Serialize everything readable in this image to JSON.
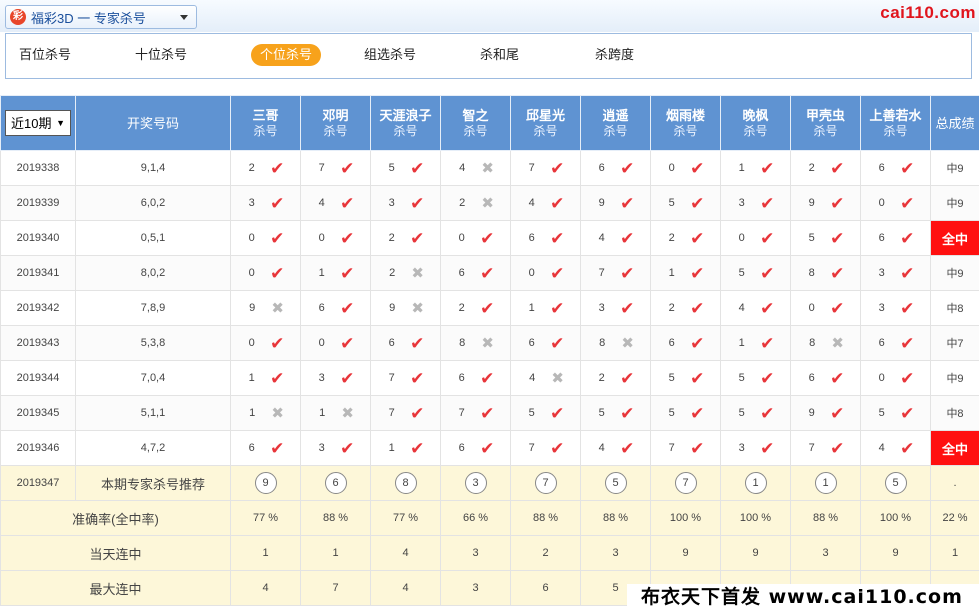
{
  "header": {
    "lottery_title": "福彩3D 一 专家杀号",
    "logo_glyph": "彩",
    "brand_url": "cai110.com"
  },
  "nav": {
    "items": [
      "百位杀号",
      "十位杀号",
      "个位杀号",
      "组选杀号",
      "杀和尾",
      "杀跨度"
    ],
    "active_index": 2
  },
  "table": {
    "period_select": "近10期",
    "col_draw": "开奖号码",
    "col_result": "总成绩",
    "sub_label": "杀号",
    "experts": [
      "三哥",
      "邓明",
      "天涯浪子",
      "智之",
      "邱星光",
      "逍遥",
      "烟雨楼",
      "晚枫",
      "甲壳虫",
      "上善若水"
    ],
    "rows": [
      {
        "period": "2019338",
        "draw": "9,1,4",
        "picks": [
          2,
          7,
          5,
          4,
          7,
          6,
          0,
          1,
          2,
          6
        ],
        "hits": [
          1,
          1,
          1,
          0,
          1,
          1,
          1,
          1,
          1,
          1
        ],
        "result": "中9"
      },
      {
        "period": "2019339",
        "draw": "6,0,2",
        "picks": [
          3,
          4,
          3,
          2,
          4,
          9,
          5,
          3,
          9,
          0
        ],
        "hits": [
          1,
          1,
          1,
          0,
          1,
          1,
          1,
          1,
          1,
          1
        ],
        "result": "中9"
      },
      {
        "period": "2019340",
        "draw": "0,5,1",
        "picks": [
          0,
          0,
          2,
          0,
          6,
          4,
          2,
          0,
          5,
          6
        ],
        "hits": [
          1,
          1,
          1,
          1,
          1,
          1,
          1,
          1,
          1,
          1
        ],
        "result": "全中"
      },
      {
        "period": "2019341",
        "draw": "8,0,2",
        "picks": [
          0,
          1,
          2,
          6,
          0,
          7,
          1,
          5,
          8,
          3
        ],
        "hits": [
          1,
          1,
          0,
          1,
          1,
          1,
          1,
          1,
          1,
          1
        ],
        "result": "中9"
      },
      {
        "period": "2019342",
        "draw": "7,8,9",
        "picks": [
          9,
          6,
          9,
          2,
          1,
          3,
          2,
          4,
          0,
          3
        ],
        "hits": [
          0,
          1,
          0,
          1,
          1,
          1,
          1,
          1,
          1,
          1
        ],
        "result": "中8"
      },
      {
        "period": "2019343",
        "draw": "5,3,8",
        "picks": [
          0,
          0,
          6,
          8,
          6,
          8,
          6,
          1,
          8,
          6
        ],
        "hits": [
          1,
          1,
          1,
          0,
          1,
          0,
          1,
          1,
          0,
          1
        ],
        "result": "中7"
      },
      {
        "period": "2019344",
        "draw": "7,0,4",
        "picks": [
          1,
          3,
          7,
          6,
          4,
          2,
          5,
          5,
          6,
          0
        ],
        "hits": [
          1,
          1,
          1,
          1,
          0,
          1,
          1,
          1,
          1,
          1
        ],
        "result": "中9"
      },
      {
        "period": "2019345",
        "draw": "5,1,1",
        "picks": [
          1,
          1,
          7,
          7,
          5,
          5,
          5,
          5,
          9,
          5
        ],
        "hits": [
          0,
          0,
          1,
          1,
          1,
          1,
          1,
          1,
          1,
          1
        ],
        "result": "中8"
      },
      {
        "period": "2019346",
        "draw": "4,7,2",
        "picks": [
          6,
          3,
          1,
          6,
          7,
          4,
          7,
          3,
          7,
          4
        ],
        "hits": [
          1,
          1,
          1,
          1,
          1,
          1,
          1,
          1,
          1,
          1
        ],
        "result": "全中"
      }
    ],
    "recommend": {
      "period": "2019347",
      "label": "本期专家杀号推荐",
      "picks": [
        9,
        6,
        8,
        3,
        7,
        5,
        7,
        1,
        1,
        5
      ],
      "result": "."
    },
    "accuracy": {
      "label": "准确率(全中率)",
      "values": [
        "77 %",
        "88 %",
        "77 %",
        "66 %",
        "88 %",
        "88 %",
        "100 %",
        "100 %",
        "88 %",
        "100 %"
      ],
      "result": "22 %"
    },
    "today_streak": {
      "label": "当天连中",
      "values": [
        "1",
        "1",
        "4",
        "3",
        "2",
        "3",
        "9",
        "9",
        "3",
        "9"
      ],
      "result": "1"
    },
    "max_streak": {
      "label": "最大连中",
      "values": [
        "4",
        "7",
        "4",
        "3",
        "6",
        "5",
        "",
        "",
        "",
        ""
      ],
      "result": ""
    }
  },
  "watermark": "布衣天下首发 www.cai110.com",
  "colors": {
    "header_blue": "#5f93d2",
    "hit_red": "#e8353a",
    "all_hit_bg": "#ff1010",
    "active_tab": "#f7a21b",
    "summary_bg": "#fdf7d9"
  }
}
